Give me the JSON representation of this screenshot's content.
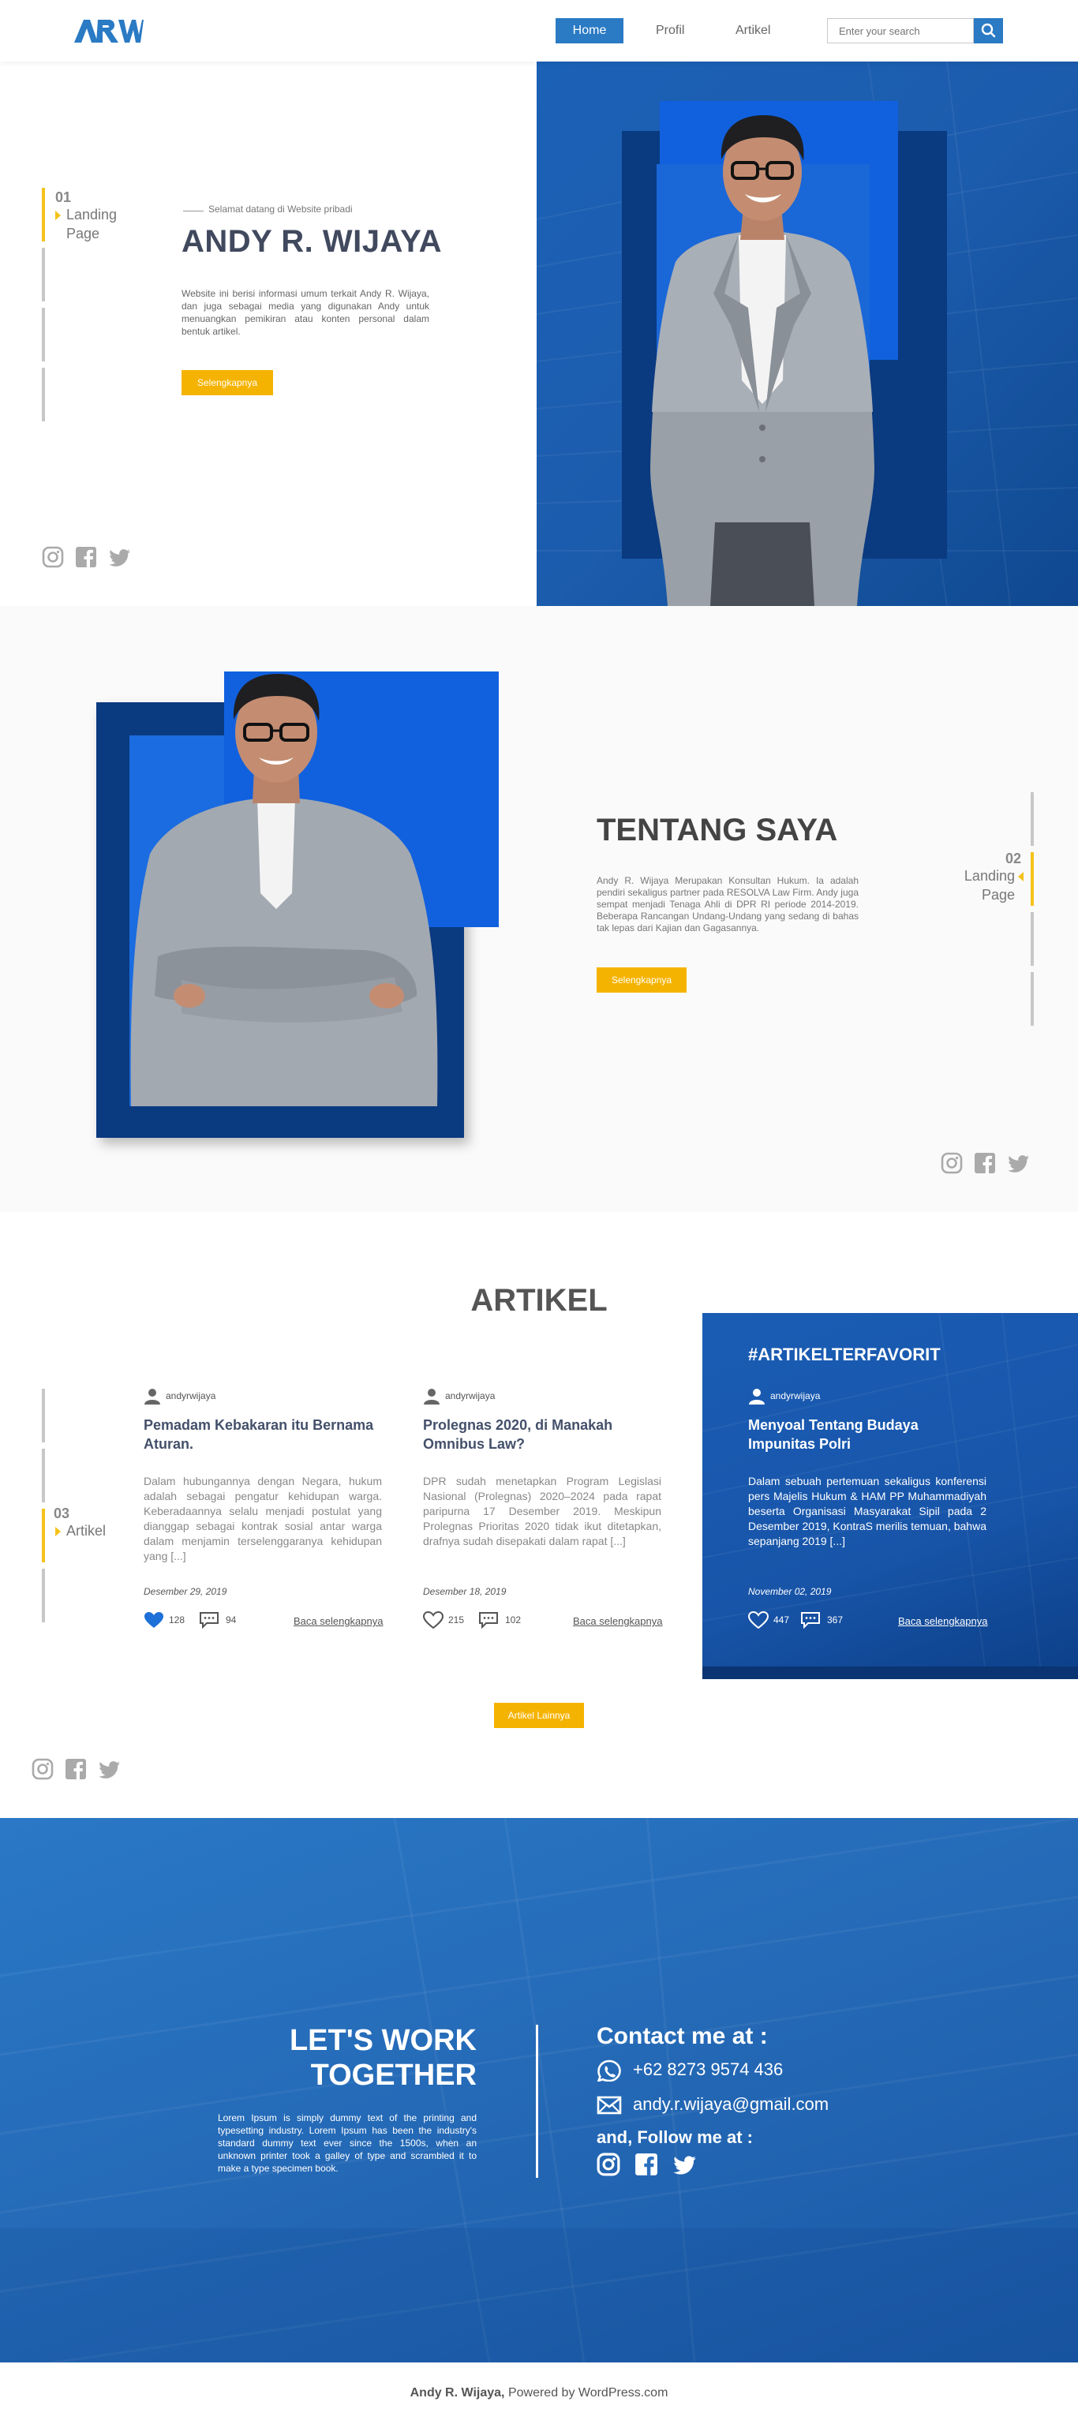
{
  "header": {
    "logo_text": "ARW",
    "nav": {
      "home": "Home",
      "profil": "Profil",
      "artikel": "Artikel"
    },
    "search_placeholder": "Enter your search"
  },
  "hero": {
    "nav_number": "01",
    "nav_label_line1": "Landing",
    "nav_label_line2": "Page",
    "welcome": "Selamat datang di Website pribadi",
    "name": "ANDY R. WIJAYA",
    "description": "Website ini berisi informasi umum terkait Andy R. Wijaya, dan juga sebagai media yang digunakan Andy untuk menuangkan pemikiran atau konten personal dalam bentuk artikel.",
    "button": "Selengkapnya"
  },
  "about": {
    "nav_number": "02",
    "nav_label_line1": "Landing",
    "nav_label_line2": "Page",
    "title": "TENTANG SAYA",
    "description": "Andy R. Wijaya Merupakan Konsultan Hukum. Ia adalah pendiri sekaligus partner pada RESOLVA Law Firm. Andy juga sempat menjadi Tenaga Ahli di DPR RI periode 2014-2019. Beberapa Rancangan Undang-Undang yang sedang di bahas tak lepas dari Kajian dan Gagasannya.",
    "button": "Selengkapnya"
  },
  "articles": {
    "title": "ARTIKEL",
    "nav_number": "03",
    "nav_label": "Artikel",
    "items": [
      {
        "author": "andyrwijaya",
        "heading": "Pemadam Kebakaran itu Bernama Aturan.",
        "body": "Dalam hubungannya dengan Negara, hukum adalah sebagai pengatur kehidupan warga. Keberadaannya selalu menjadi postulat yang dianggap sebagai kontrak sosial antar warga dalam menjamin terselenggaranya kehidupan yang [...]",
        "date": "Desember 29, 2019",
        "likes": "128",
        "comments": "94",
        "read_more": "Baca selengkapnya"
      },
      {
        "author": "andyrwijaya",
        "heading": "Prolegnas 2020, di Manakah Omnibus Law?",
        "body": "DPR sudah menetapkan Program Legislasi Nasional (Prolegnas) 2020–2024 pada rapat paripurna 17 Desember 2019. Meskipun Prolegnas Prioritas 2020 tidak ikut ditetapkan, drafnya sudah disepakati dalam rapat [...]",
        "date": "Desember 18, 2019",
        "likes": "215",
        "comments": "102",
        "read_more": "Baca selengkapnya"
      }
    ],
    "favorite": {
      "tag": "#ARTIKELTERFAVORIT",
      "author": "andyrwijaya",
      "heading": "Menyoal Tentang Budaya Impunitas Polri",
      "body": "Dalam sebuah pertemuan sekaligus konferensi pers Majelis Hukum & HAM PP Muhammadiyah beserta Organisasi Masyarakat Sipil pada 2 Desember 2019, KontraS merilis temuan, bahwa sepanjang 2019 [...]",
      "date": "November 02, 2019",
      "likes": "447",
      "comments": "367",
      "read_more": "Baca selengkapnya"
    },
    "more_button": "Artikel Lainnya"
  },
  "footer": {
    "lwt_line1": "LET'S WORK",
    "lwt_line2": "TOGETHER",
    "lwt_desc": "Lorem Ipsum is simply dummy text of the printing and typesetting industry. Lorem Ipsum has been the industry's standard dummy text ever since the 1500s, when an unknown printer took a galley of type and scrambled it to make a type specimen book.",
    "contact_title": "Contact me at :",
    "phone": "+62 8273 9574 436",
    "email": "andy.r.wijaya@gmail.com",
    "follow": "and, Follow me at :"
  },
  "credits": {
    "name": "Andy R. Wijaya,",
    "powered": " Powered by WordPress.com"
  },
  "colors": {
    "accent_blue": "#2a7ac4",
    "dark_blue": "#0a3a80",
    "yellow": "#f5b301"
  }
}
